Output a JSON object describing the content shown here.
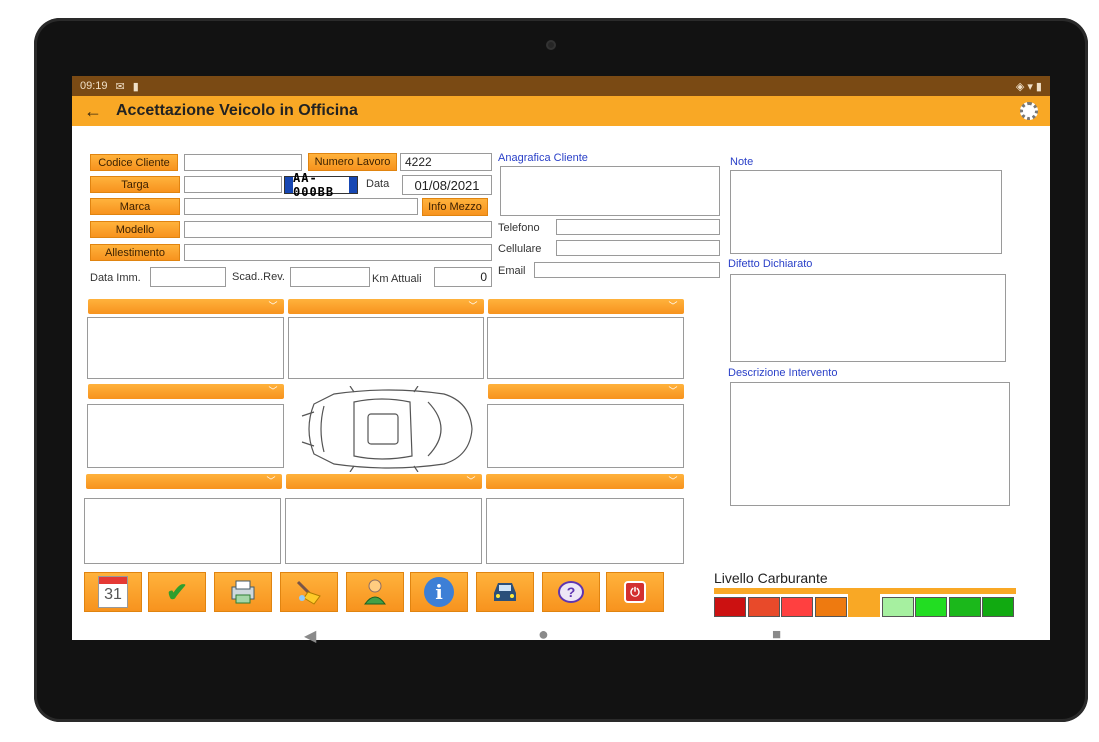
{
  "statusbar": {
    "time": "09:19",
    "right_icons": "◈ ▾ ▮"
  },
  "appbar": {
    "title": "Accettazione Veicolo in Officina"
  },
  "form": {
    "codice_cliente_label": "Codice Cliente",
    "codice_cliente_value": "",
    "numero_lavoro_label": "Numero Lavoro",
    "numero_lavoro_value": "4222",
    "targa_label": "Targa",
    "targa_value": "",
    "plate_value": "AA-000BB",
    "data_label": "Data",
    "data_value": "01/08/2021",
    "marca_label": "Marca",
    "marca_value": "",
    "info_mezzo_label": "Info Mezzo",
    "modello_label": "Modello",
    "modello_value": "",
    "allestimento_label": "Allestimento",
    "allestimento_value": "",
    "data_imm_label": "Data Imm.",
    "data_imm_value": "",
    "scad_rev_label": "Scad..Rev.",
    "scad_rev_value": "",
    "km_attuali_label": "Km Attuali",
    "km_attuali_value": "0"
  },
  "anagrafica": {
    "title": "Anagrafica Cliente",
    "telefono_label": "Telefono",
    "cellulare_label": "Cellulare",
    "email_label": "Email"
  },
  "notes": {
    "note_label": "Note",
    "difetto_label": "Difetto Dichiarato",
    "descrizione_label": "Descrizione Intervento"
  },
  "toolbar": {
    "calendar_day": "31"
  },
  "fuel": {
    "label": "Livello Carburante",
    "colors": [
      "#cc1111",
      "#e84a2a",
      "#ff4040",
      "#ee7a10",
      "#f9a825",
      "#a6f0a0",
      "#22dd22",
      "#1bb81b",
      "#11aa11"
    ],
    "selected_index": 4
  },
  "colors": {
    "accent": "#f9a825",
    "button": "#f7931e",
    "link_blue": "#2a40c8"
  }
}
